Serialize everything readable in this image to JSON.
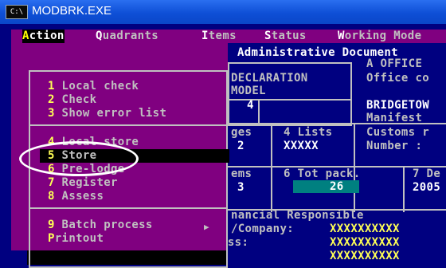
{
  "window": {
    "title": "MODBRK.EXE",
    "icon": "C:\\"
  },
  "menubar": [
    {
      "hot": "A",
      "rest": "ction",
      "selected": true
    },
    {
      "hot": "Q",
      "rest": "uadrants",
      "selected": false
    },
    {
      "hot": "I",
      "rest": "tems",
      "selected": false
    },
    {
      "hot": "S",
      "rest": "tatus",
      "selected": false
    },
    {
      "hot": "W",
      "rest": "orking Mode",
      "selected": false
    }
  ],
  "action_menu": {
    "items": [
      {
        "num": "1",
        "label": " Local check"
      },
      {
        "num": "2",
        "label": " Check"
      },
      {
        "num": "3",
        "label": " Show error list"
      },
      {
        "num": "4",
        "label": " Local store"
      },
      {
        "num": "5",
        "label": " Store"
      },
      {
        "num": "6",
        "label": " Pre-lodge"
      },
      {
        "num": "7",
        "label": " Register"
      },
      {
        "num": "8",
        "label": " Assess"
      },
      {
        "num": "9",
        "label": " Batch process"
      },
      {
        "num": "P",
        "label": "rintout"
      }
    ],
    "submenu_arrow": "▶"
  },
  "form": {
    "admin_doc": "Administrative Document",
    "a_office": "A OFFICE",
    "office_co": "Office co",
    "declaration": "DECLARATION",
    "model": "MODEL",
    "model_value": "4",
    "bridgetown": "BRIDGETOW",
    "manifest": "Manifest",
    "pages_label": "ges",
    "pages_value": "2",
    "lists_label": "4 Lists",
    "lists_value": "XXXXX",
    "customs": "Customs r",
    "number": "Number :",
    "items_label": "ems",
    "items_value": "3",
    "tot_pack_label": "6 Tot pack.",
    "tot_pack_value": "26",
    "de_label": "7 De",
    "de_value": "2005",
    "financial": "nancial Responsible",
    "company": "/Company:",
    "company_value": "XXXXXXXXXX",
    "address": "Address:",
    "address_value1": "XXXXXXXXXX",
    "address_value2": "XXXXXXXXXX"
  }
}
